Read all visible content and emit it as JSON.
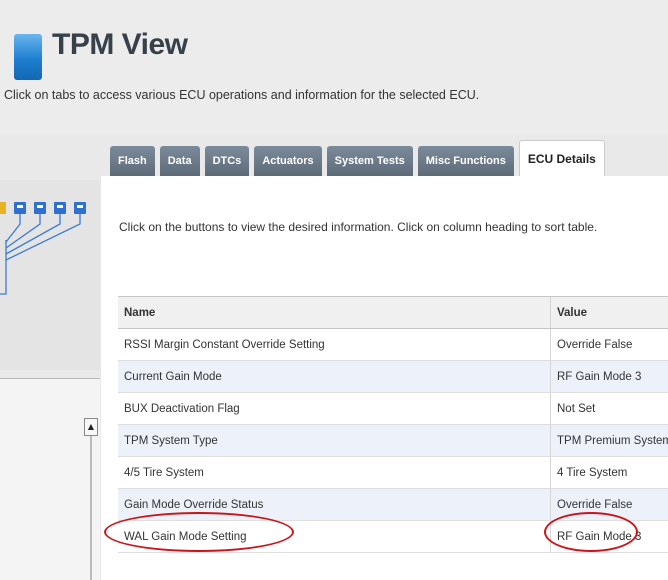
{
  "header": {
    "title": "TPM View",
    "subtitle": "Click on tabs to access various ECU operations and information for the selected ECU."
  },
  "tabs": [
    {
      "label": "Flash",
      "active": false
    },
    {
      "label": "Data",
      "active": false
    },
    {
      "label": "DTCs",
      "active": false
    },
    {
      "label": "Actuators",
      "active": false
    },
    {
      "label": "System Tests",
      "active": false
    },
    {
      "label": "Misc Functions",
      "active": false
    },
    {
      "label": "ECU Details",
      "active": true
    }
  ],
  "content": {
    "instruction": "Click on the buttons to view the desired information.  Click on column heading to sort table."
  },
  "table": {
    "columns": [
      "Name",
      "Value"
    ],
    "rows": [
      {
        "name": "RSSI Margin Constant Override Setting",
        "value": "Override False"
      },
      {
        "name": "Current Gain Mode",
        "value": "RF Gain Mode 3"
      },
      {
        "name": "BUX Deactivation Flag",
        "value": "Not Set"
      },
      {
        "name": "TPM System Type",
        "value": "TPM Premium System"
      },
      {
        "name": "4/5 Tire System",
        "value": "4 Tire System"
      },
      {
        "name": "Gain Mode Override Status",
        "value": "Override False"
      },
      {
        "name": "WAL Gain Mode Setting",
        "value": "RF Gain Mode 3"
      }
    ]
  },
  "colors": {
    "title_icon": "#1e7fd0",
    "tab_bg": "#6b7886",
    "highlight_circle": "#c9161d",
    "tree_node": "#2f6fcf"
  }
}
